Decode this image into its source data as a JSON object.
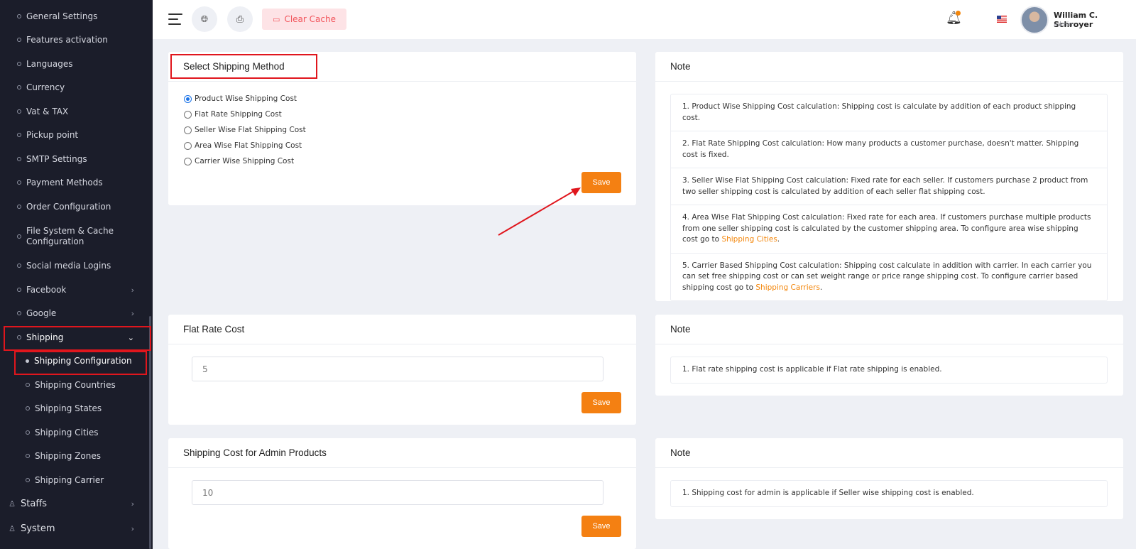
{
  "sidebar": {
    "items": [
      {
        "label": "General Settings"
      },
      {
        "label": "Features activation"
      },
      {
        "label": "Languages"
      },
      {
        "label": "Currency"
      },
      {
        "label": "Vat & TAX"
      },
      {
        "label": "Pickup point"
      },
      {
        "label": "SMTP Settings"
      },
      {
        "label": "Payment Methods"
      },
      {
        "label": "Order Configuration"
      },
      {
        "label": "File System & Cache Configuration"
      },
      {
        "label": "Social media Logins"
      },
      {
        "label": "Facebook"
      },
      {
        "label": "Google"
      },
      {
        "label": "Shipping"
      }
    ],
    "shipping_sub": [
      {
        "label": "Shipping Configuration"
      },
      {
        "label": "Shipping Countries"
      },
      {
        "label": "Shipping States"
      },
      {
        "label": "Shipping Cities"
      },
      {
        "label": "Shipping Zones"
      },
      {
        "label": "Shipping Carrier"
      }
    ],
    "staffs": "Staffs",
    "system": "System"
  },
  "header": {
    "clear_cache": "Clear Cache",
    "user_name": "William C. Schroyer",
    "user_role": "admin"
  },
  "shipping_method": {
    "title": "Select Shipping Method",
    "options": [
      {
        "label": "Product Wise Shipping Cost",
        "checked": true
      },
      {
        "label": "Flat Rate Shipping Cost",
        "checked": false
      },
      {
        "label": "Seller Wise Flat Shipping Cost",
        "checked": false
      },
      {
        "label": "Area Wise Flat Shipping Cost",
        "checked": false
      },
      {
        "label": "Carrier Wise Shipping Cost",
        "checked": false
      }
    ],
    "save": "Save"
  },
  "note1": {
    "title": "Note",
    "item1": "1. Product Wise Shipping Cost calculation: Shipping cost is calculate by addition of each product shipping cost.",
    "item2": "2. Flat Rate Shipping Cost calculation: How many products a customer purchase, doesn't matter. Shipping cost is fixed.",
    "item3": "3. Seller Wise Flat Shipping Cost calculation: Fixed rate for each seller. If customers purchase 2 product from two seller shipping cost is calculated by addition of each seller flat shipping cost.",
    "item4_text": "4. Area Wise Flat Shipping Cost calculation: Fixed rate for each area. If customers purchase multiple products from one seller shipping cost is calculated by the customer shipping area. To configure area wise shipping cost go to",
    "item4_link": "Shipping Cities",
    "item5_text": "5. Carrier Based Shipping Cost calculation: Shipping cost calculate in addition with carrier. In each carrier you can set free shipping cost or can set weight range or price range shipping cost. To configure carrier based shipping cost go to",
    "item5_link": "Shipping Carriers",
    "period": "."
  },
  "flat_rate": {
    "title": "Flat Rate Cost",
    "value": "5",
    "save": "Save"
  },
  "note2": {
    "title": "Note",
    "item1": "1. Flat rate shipping cost is applicable if Flat rate shipping is enabled."
  },
  "admin_cost": {
    "title": "Shipping Cost for Admin Products",
    "value": "10",
    "save": "Save"
  },
  "note3": {
    "title": "Note",
    "item1": "1. Shipping cost for admin is applicable if Seller wise shipping cost is enabled."
  },
  "colors": {
    "accent": "#f48012",
    "highlight": "#e0161d",
    "sidebar_bg": "#1b1d2a"
  }
}
